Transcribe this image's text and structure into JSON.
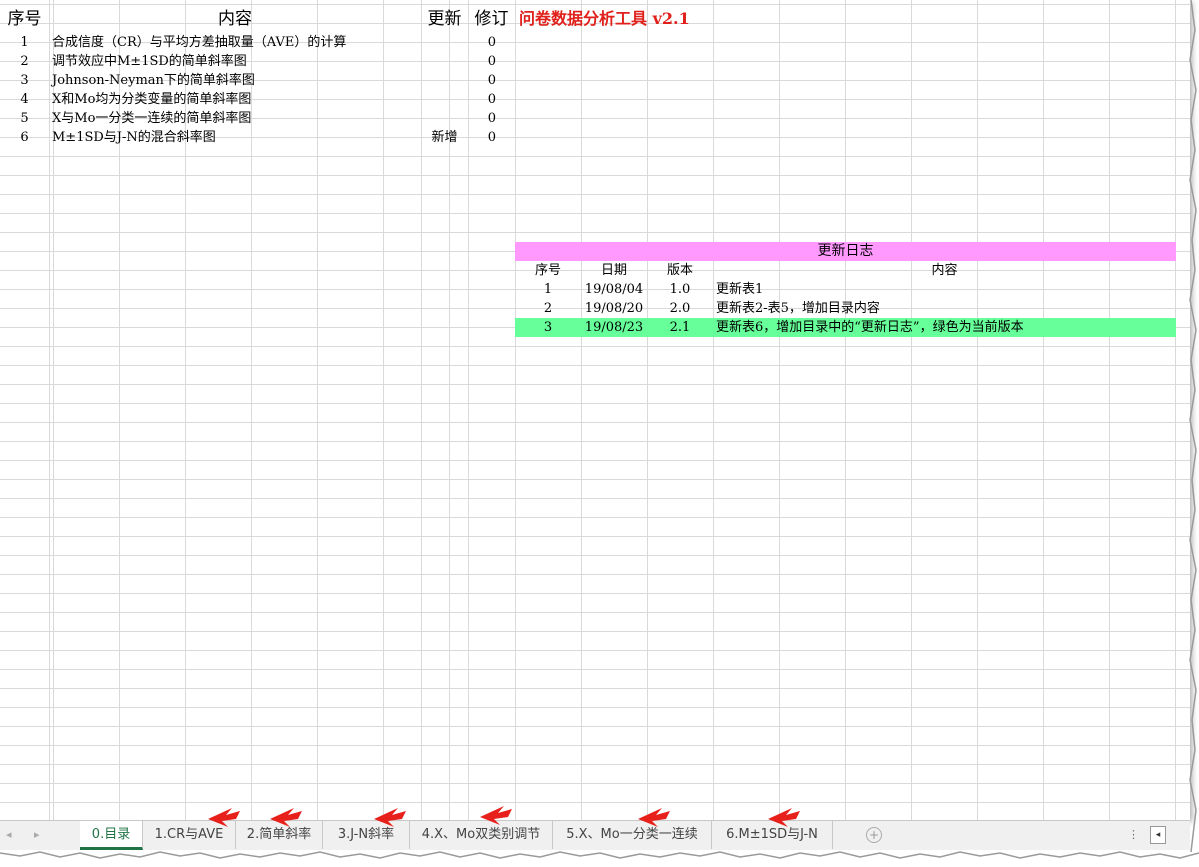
{
  "toc": {
    "headers": [
      "序号",
      "内容",
      "更新",
      "修订"
    ],
    "tool_title": "问卷数据分析工具 v2.1",
    "rows": [
      {
        "no": "1",
        "content": "合成信度（CR）与平均方差抽取量（AVE）的计算",
        "update": "",
        "revision": "0"
      },
      {
        "no": "2",
        "content": "调节效应中M±1SD的简单斜率图",
        "update": "",
        "revision": "0"
      },
      {
        "no": "3",
        "content": "Johnson-Neyman下的简单斜率图",
        "update": "",
        "revision": "0"
      },
      {
        "no": "4",
        "content": "X和Mo均为分类变量的简单斜率图",
        "update": "",
        "revision": "0"
      },
      {
        "no": "5",
        "content": "X与Mo一分类一连续的简单斜率图",
        "update": "",
        "revision": "0"
      },
      {
        "no": "6",
        "content": "M±1SD与J-N的混合斜率图",
        "update": "新增",
        "revision": "0"
      }
    ]
  },
  "changelog": {
    "title": "更新日志",
    "headers": [
      "序号",
      "日期",
      "版本",
      "内容"
    ],
    "rows": [
      {
        "no": "1",
        "date": "19/08/04",
        "version": "1.0",
        "content": "更新表1"
      },
      {
        "no": "2",
        "date": "19/08/20",
        "version": "2.0",
        "content": "更新表2-表5，增加目录内容"
      },
      {
        "no": "3",
        "date": "19/08/23",
        "version": "2.1",
        "content": "更新表6，增加目录中的“更新日志”，绿色为当前版本"
      }
    ],
    "current_row_color": "#66ff99",
    "title_color": "#ff99ff"
  },
  "tabs": [
    {
      "label": "0.目录",
      "active": true
    },
    {
      "label": "1.CR与AVE",
      "active": false
    },
    {
      "label": "2.简单斜率",
      "active": false
    },
    {
      "label": "3.J-N斜率",
      "active": false
    },
    {
      "label": "4.X、Mo双类别调节",
      "active": false
    },
    {
      "label": "5.X、Mo一分类一连续",
      "active": false
    },
    {
      "label": "6.M±1SD与J-N",
      "active": false
    }
  ],
  "colors": {
    "tool_title": "#e0201b",
    "active_tab": "#217346",
    "arrow": "#e8201c"
  }
}
